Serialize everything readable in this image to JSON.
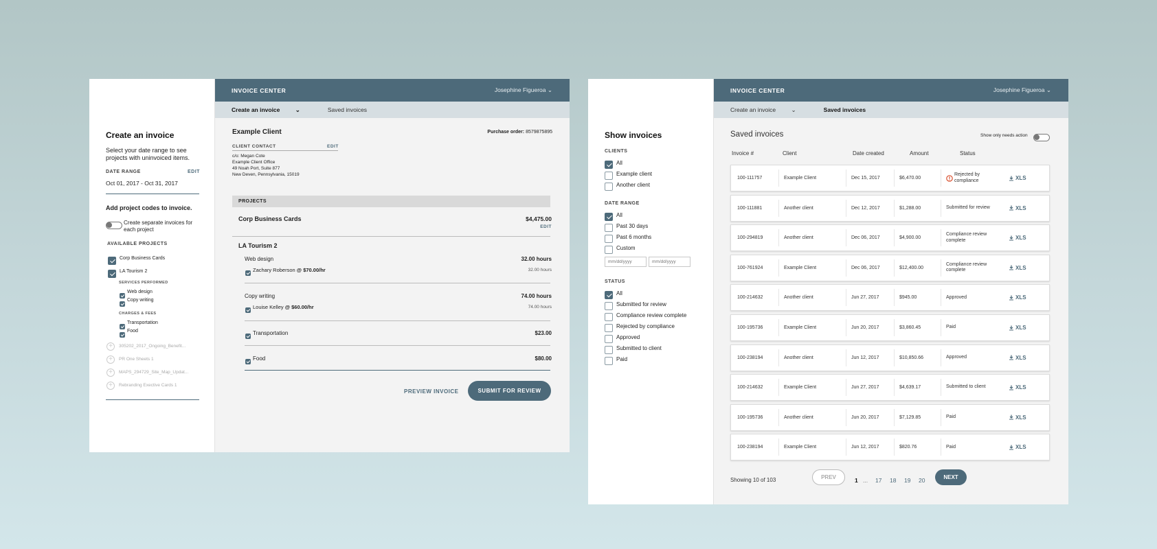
{
  "left_panel": {
    "header": {
      "title": "INVOICE CENTER",
      "user": "Josephine Figueroa"
    },
    "nav": {
      "create": "Create an invoice",
      "saved": "Saved invoices"
    },
    "sidebar": {
      "title": "Create an invoice",
      "description": "Select your date range to see projects with uninvoiced items.",
      "date_range_label": "DATE RANGE",
      "edit": "EDIT",
      "date_range_value": "Oct 01, 2017 - Oct 31, 2017",
      "add_codes": "Add project codes to invoice.",
      "separate_toggle": "Create separate invoices for each project",
      "available_label": "AVAILABLE PROJECTS",
      "projects": [
        "Corp Business Cards",
        "LA Tourism 2"
      ],
      "services_label": "SERVICES PERFORMED",
      "services": [
        "Web design",
        "Copy writing"
      ],
      "charges_label": "CHARGES & FEES",
      "charges": [
        "Transportation",
        "Food"
      ],
      "inactive_projects": [
        "305202_2017_Ongoing_Benefit...",
        "PR One Sheets 1",
        "MAPS_294729_Site_Map_Updat...",
        "Rebranding Exective Cards 1"
      ]
    },
    "invoice": {
      "client": "Example Client",
      "po_label": "Purchase order:",
      "po_value": "8579875895",
      "contact_label": "CLIENT CONTACT",
      "edit": "EDIT",
      "address": [
        "c/o: Megan Cote",
        "Example Client Office",
        "49 Noah Port, Suite 877",
        "New Deven, Pennsylvania, 15019"
      ],
      "projects_label": "PROJECTS",
      "corp": {
        "name": "Corp Business Cards",
        "amount": "$4,475.00",
        "edit": "EDIT"
      },
      "la": {
        "name": "LA Tourism 2",
        "web": {
          "label": "Web design",
          "hours": "32.00 hours",
          "person": "Zachary Roberson",
          "rate": "@ $70.00/hr",
          "sub_hours": "32.00 hours"
        },
        "copy": {
          "label": "Copy writing",
          "hours": "74.00 hours",
          "person": "Louise Kelley",
          "rate": "@ $60.00/hr",
          "sub_hours": "74.00 hours"
        },
        "transport": {
          "label": "Transportation",
          "amount": "$23.00"
        },
        "food": {
          "label": "Food",
          "amount": "$80.00"
        }
      },
      "preview": "PREVIEW INVOICE",
      "submit": "SUBMIT FOR REVIEW"
    }
  },
  "right_panel": {
    "header": {
      "title": "INVOICE CENTER",
      "user": "Josephine Figueroa"
    },
    "nav": {
      "create": "Create an invoice",
      "saved": "Saved invoices"
    },
    "filters": {
      "title": "Show invoices",
      "clients_label": "CLIENTS",
      "clients": [
        {
          "label": "All",
          "checked": true
        },
        {
          "label": "Example client",
          "checked": false
        },
        {
          "label": "Another client",
          "checked": false
        }
      ],
      "date_label": "DATE RANGE",
      "dates": [
        {
          "label": "All",
          "checked": true
        },
        {
          "label": "Past 30 days",
          "checked": false
        },
        {
          "label": "Past 6 months",
          "checked": false
        },
        {
          "label": "Custom",
          "checked": false
        }
      ],
      "date_placeholder": "mm/dd/yyyy",
      "status_label": "STATUS",
      "statuses": [
        {
          "label": "All",
          "checked": true
        },
        {
          "label": "Submitted for review",
          "checked": false
        },
        {
          "label": "Compliance review complete",
          "checked": false
        },
        {
          "label": "Rejected by compliance",
          "checked": false
        },
        {
          "label": "Approved",
          "checked": false
        },
        {
          "label": "Submitted to client",
          "checked": false
        },
        {
          "label": "Paid",
          "checked": false
        }
      ]
    },
    "list": {
      "title": "Saved invoices",
      "toggle_label": "Show only needs action",
      "columns": [
        "Invoice #",
        "Client",
        "Date created",
        "Amount",
        "Status"
      ],
      "rows": [
        {
          "id": "100-111757",
          "client": "Example Client",
          "date": "Dec 15, 2017",
          "amount": "$6,470.00",
          "status": "Rejected by compliance",
          "alert": true
        },
        {
          "id": "100-111881",
          "client": "Another client",
          "date": "Dec 12, 2017",
          "amount": "$1,288.00",
          "status": "Submitted for review",
          "alert": false
        },
        {
          "id": "100-294819",
          "client": "Another client",
          "date": "Dec 06, 2017",
          "amount": "$4,900.00",
          "status": "Compliance review complete",
          "alert": false
        },
        {
          "id": "100-761924",
          "client": "Example Client",
          "date": "Dec 06, 2017",
          "amount": "$12,400.00",
          "status": "Compliance review complete",
          "alert": false
        },
        {
          "id": "100-214632",
          "client": "Another client",
          "date": "Jun 27, 2017",
          "amount": "$945.00",
          "status": "Approved",
          "alert": false
        },
        {
          "id": "100-195736",
          "client": "Example Client",
          "date": "Jun 20, 2017",
          "amount": "$3,860.45",
          "status": "Paid",
          "alert": false
        },
        {
          "id": "100-238194",
          "client": "Another client",
          "date": "Jun 12, 2017",
          "amount": "$10,850.66",
          "status": "Approved",
          "alert": false
        },
        {
          "id": "100-214632",
          "client": "Example Client",
          "date": "Jun 27, 2017",
          "amount": "$4,639.17",
          "status": "Submitted to client",
          "alert": false
        },
        {
          "id": "100-195736",
          "client": "Another client",
          "date": "Jun 20, 2017",
          "amount": "$7,129.85",
          "status": "Paid",
          "alert": false
        },
        {
          "id": "100-238194",
          "client": "Example Client",
          "date": "Jun 12, 2017",
          "amount": "$820.76",
          "status": "Paid",
          "alert": false
        }
      ],
      "xls": "XLS",
      "showing": "Showing 10 of 103",
      "prev": "PREV",
      "pages": [
        "1",
        "...",
        "17",
        "18",
        "19",
        "20"
      ],
      "next": "NEXT"
    }
  },
  "colors": {
    "accent": "#4d6a7a",
    "alert": "#d9502f"
  }
}
